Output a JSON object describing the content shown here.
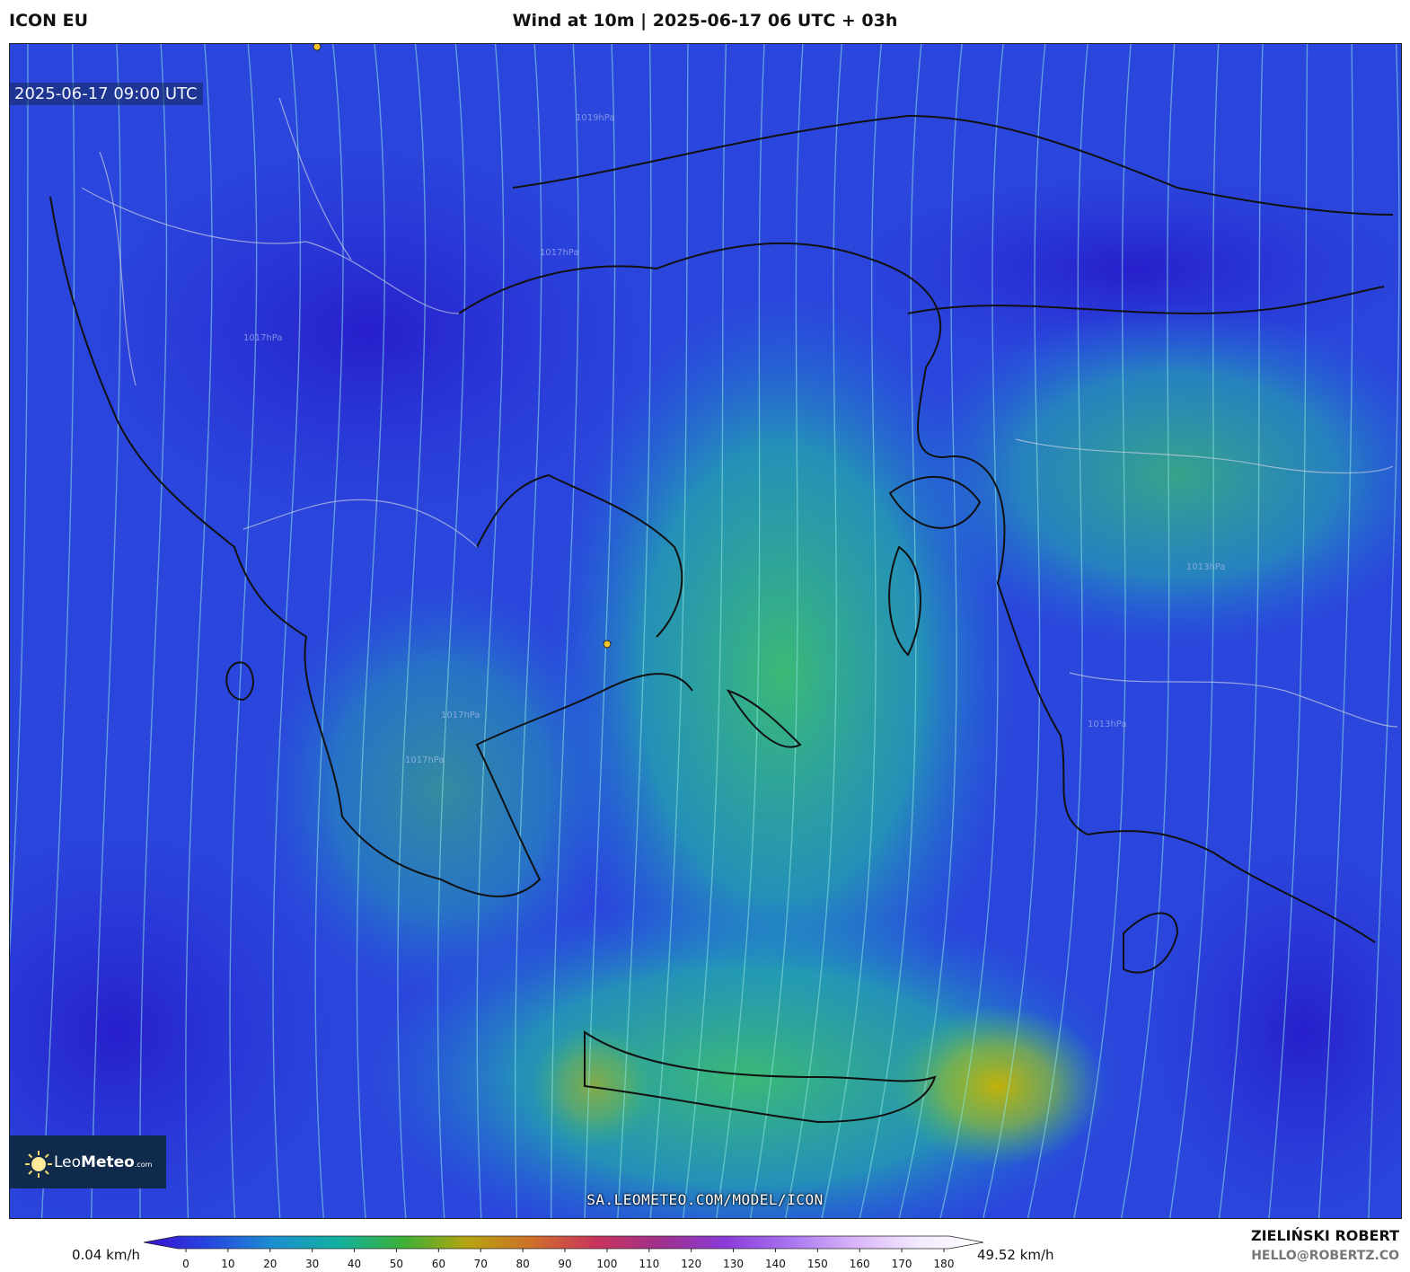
{
  "header": {
    "model": "ICON EU",
    "title": "Wind at 10m | 2025-06-17 06 UTC + 03h"
  },
  "map": {
    "valid_time": "2025-06-17 09:00 UTC",
    "pressure_labels": [
      "1019hPa",
      "1017hPa",
      "1017hPa",
      "1013hPa",
      "1013hPa",
      "1017hPa",
      "1017hPa"
    ],
    "colors": {
      "calm": "#2a2fd6",
      "mid": "#2cc3a0",
      "strong": "#c8b800"
    }
  },
  "logo": {
    "brand_light": "Leo",
    "brand_bold": "Meteo",
    "suffix": ".com"
  },
  "footer": {
    "url": "SA.LEOMETEO.COM/MODEL/ICON"
  },
  "colorbar": {
    "min_label": "0.04 km/h",
    "max_label": "49.52 km/h",
    "ticks": [
      "0",
      "10",
      "20",
      "30",
      "40",
      "50",
      "60",
      "70",
      "80",
      "90",
      "100",
      "110",
      "120",
      "130",
      "140",
      "150",
      "160",
      "170",
      "180"
    ],
    "gradient_colors": [
      "#3b0fd0",
      "#2646e0",
      "#1c8fd0",
      "#12b0a0",
      "#3cb038",
      "#b4a410",
      "#d0702a",
      "#c8345c",
      "#a0308c",
      "#8a3ad8",
      "#a874f0",
      "#d8b4f8",
      "#f4eaff",
      "#ffffff"
    ]
  },
  "credit": {
    "author": "ZIELIŃSKI ROBERT",
    "email": "HELLO@ROBERTZ.CO"
  }
}
